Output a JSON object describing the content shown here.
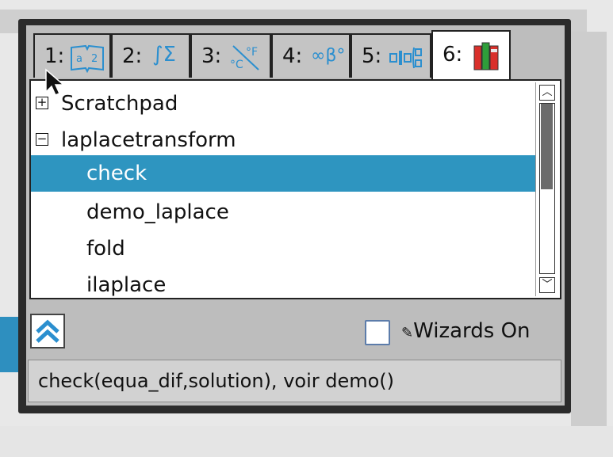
{
  "tabs": [
    {
      "num": "1:",
      "icon": "book-icon",
      "glyph": "a|2"
    },
    {
      "num": "2:",
      "icon": "integral-sum-icon",
      "glyph": "∫Σ"
    },
    {
      "num": "3:",
      "icon": "unit-conversion-icon",
      "glyph": "°C°F"
    },
    {
      "num": "4:",
      "icon": "symbols-icon",
      "glyph": "∞β°"
    },
    {
      "num": "5:",
      "icon": "templates-icon",
      "glyph": "▫▯▫"
    },
    {
      "num": "6:",
      "icon": "library-books-icon",
      "glyph": ""
    }
  ],
  "tree": {
    "items": [
      {
        "label": "Scratchpad",
        "expander": "+"
      },
      {
        "label": "laplacetransform",
        "expander": "−"
      },
      {
        "label": "check",
        "selected": true
      },
      {
        "label": "demo_laplace"
      },
      {
        "label": "fold"
      },
      {
        "label": "ilaplace"
      }
    ]
  },
  "wizards": {
    "label": "Wizards On",
    "checked": false
  },
  "help_text": "check(equa_dif,solution), voir demo()",
  "colors": {
    "selection": "#2e95c0",
    "accent": "#2b8fcf"
  }
}
